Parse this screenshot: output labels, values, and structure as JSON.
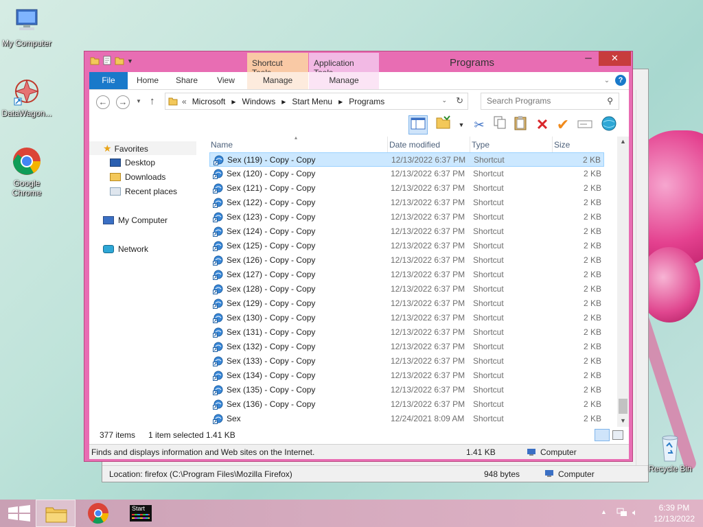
{
  "desktop": {
    "icons": [
      {
        "label": "My Computer"
      },
      {
        "label": "DataWagon..."
      },
      {
        "label": "Google Chrome"
      },
      {
        "label": "Recycle Bin"
      }
    ]
  },
  "back_window": {
    "location": "Location: firefox (C:\\Program Files\\Mozilla Firefox)",
    "size": "948 bytes",
    "zone": "Computer"
  },
  "window": {
    "title": "Programs",
    "context_tabs": [
      {
        "group": "Shortcut Tools",
        "tab": "Manage"
      },
      {
        "group": "Application Tools",
        "tab": "Manage"
      }
    ],
    "ribbon_tabs": [
      "File",
      "Home",
      "Share",
      "View"
    ],
    "controls": {
      "minimize": "─",
      "maximize": "□",
      "close": "✕"
    },
    "address": {
      "prefix": "«",
      "crumbs": [
        "Microsoft",
        "Windows",
        "Start Menu",
        "Programs"
      ]
    },
    "search": {
      "placeholder": "Search Programs"
    },
    "nav": {
      "favorites": "Favorites",
      "favorite_items": [
        "Desktop",
        "Downloads",
        "Recent places"
      ],
      "computer": "My Computer",
      "network": "Network"
    },
    "columns": {
      "name": "Name",
      "date": "Date modified",
      "type": "Type",
      "size": "Size"
    },
    "files": [
      {
        "name": "Sex (119) - Copy - Copy",
        "date": "12/13/2022 6:37 PM",
        "type": "Shortcut",
        "size": "2 KB",
        "selected": true
      },
      {
        "name": "Sex (120) - Copy - Copy",
        "date": "12/13/2022 6:37 PM",
        "type": "Shortcut",
        "size": "2 KB"
      },
      {
        "name": "Sex (121) - Copy - Copy",
        "date": "12/13/2022 6:37 PM",
        "type": "Shortcut",
        "size": "2 KB"
      },
      {
        "name": "Sex (122) - Copy - Copy",
        "date": "12/13/2022 6:37 PM",
        "type": "Shortcut",
        "size": "2 KB"
      },
      {
        "name": "Sex (123) - Copy - Copy",
        "date": "12/13/2022 6:37 PM",
        "type": "Shortcut",
        "size": "2 KB"
      },
      {
        "name": "Sex (124) - Copy - Copy",
        "date": "12/13/2022 6:37 PM",
        "type": "Shortcut",
        "size": "2 KB"
      },
      {
        "name": "Sex (125) - Copy - Copy",
        "date": "12/13/2022 6:37 PM",
        "type": "Shortcut",
        "size": "2 KB"
      },
      {
        "name": "Sex (126) - Copy - Copy",
        "date": "12/13/2022 6:37 PM",
        "type": "Shortcut",
        "size": "2 KB"
      },
      {
        "name": "Sex (127) - Copy - Copy",
        "date": "12/13/2022 6:37 PM",
        "type": "Shortcut",
        "size": "2 KB"
      },
      {
        "name": "Sex (128) - Copy - Copy",
        "date": "12/13/2022 6:37 PM",
        "type": "Shortcut",
        "size": "2 KB"
      },
      {
        "name": "Sex (129) - Copy - Copy",
        "date": "12/13/2022 6:37 PM",
        "type": "Shortcut",
        "size": "2 KB"
      },
      {
        "name": "Sex (130) - Copy - Copy",
        "date": "12/13/2022 6:37 PM",
        "type": "Shortcut",
        "size": "2 KB"
      },
      {
        "name": "Sex (131) - Copy - Copy",
        "date": "12/13/2022 6:37 PM",
        "type": "Shortcut",
        "size": "2 KB"
      },
      {
        "name": "Sex (132) - Copy - Copy",
        "date": "12/13/2022 6:37 PM",
        "type": "Shortcut",
        "size": "2 KB"
      },
      {
        "name": "Sex (133) - Copy - Copy",
        "date": "12/13/2022 6:37 PM",
        "type": "Shortcut",
        "size": "2 KB"
      },
      {
        "name": "Sex (134) - Copy - Copy",
        "date": "12/13/2022 6:37 PM",
        "type": "Shortcut",
        "size": "2 KB"
      },
      {
        "name": "Sex (135) - Copy - Copy",
        "date": "12/13/2022 6:37 PM",
        "type": "Shortcut",
        "size": "2 KB"
      },
      {
        "name": "Sex (136) - Copy - Copy",
        "date": "12/13/2022 6:37 PM",
        "type": "Shortcut",
        "size": "2 KB"
      },
      {
        "name": "Sex",
        "date": "12/24/2021 8:09 AM",
        "type": "Shortcut",
        "size": "2 KB"
      }
    ],
    "info": {
      "count": "377 items",
      "selection": "1 item selected  1.41 KB"
    },
    "status": {
      "text": "Finds and displays information and Web sites on the Internet.",
      "size": "1.41 KB",
      "zone": "Computer"
    }
  },
  "taskbar": {
    "start_app_label": "Start",
    "time": "6:39 PM",
    "date": "12/13/2022"
  },
  "colors": {
    "frame": "#e86db3",
    "file_tab": "#1979ca",
    "selection": "#cce8ff",
    "shortcut_tools": "#f9c9a5",
    "application_tools": "#f2b9e4"
  }
}
